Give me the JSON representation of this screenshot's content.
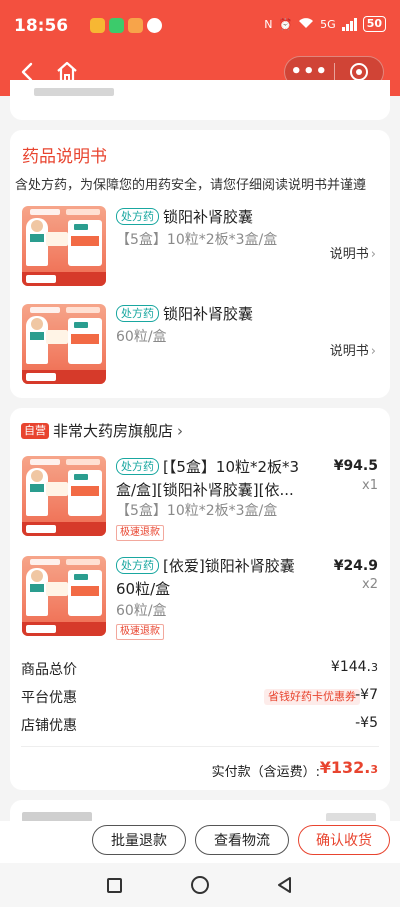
{
  "status_bar": {
    "time": "18:56",
    "network": "5G",
    "battery": "50"
  },
  "header": {
    "back_icon": "chevron-left-icon",
    "home_icon": "home-icon",
    "more_icon": "more-dots-icon",
    "close_icon": "target-icon"
  },
  "manual_section": {
    "title": "药品说明书",
    "notice": "含处方药，为保障您的用药安全，请您仔细阅读说明书并谨遵",
    "items": [
      {
        "rx": "处方药",
        "name": "锁阳补肾胶囊",
        "spec": "【5盒】10粒*2板*3盒/盒",
        "link": "说明书"
      },
      {
        "rx": "处方药",
        "name": "锁阳补肾胶囊",
        "spec": "60粒/盒",
        "link": "说明书"
      }
    ]
  },
  "store_section": {
    "self_tag": "自营",
    "store_name": "非常大药房旗舰店",
    "items": [
      {
        "rx": "处方药",
        "name_line1": "【5盒】10粒*2板*3",
        "name_line2": "盒/盒][锁阳补肾胶囊][依...",
        "name_prefix": "[",
        "spec": "【5盒】10粒*2板*3盒/盒",
        "tag": "极速退款",
        "price": "¥94.5",
        "qty": "x1"
      },
      {
        "rx": "处方药",
        "name_line1": "[依爱]锁阳补肾胶囊",
        "name_line2": "60粒/盒",
        "spec": "60粒/盒",
        "tag": "极速退款",
        "price": "¥24.9",
        "qty": "x2"
      }
    ],
    "summary": {
      "total_label": "商品总价",
      "total_value_main": "¥144.",
      "total_value_dec": "3",
      "platform_label": "平台优惠",
      "platform_coupon": "省钱好药卡优惠券",
      "platform_value": "-¥7",
      "store_label": "店铺优惠",
      "store_value": "-¥5",
      "paid_label": "实付款（含运费）:",
      "paid_value_main": "¥132.",
      "paid_value_dec": "3"
    }
  },
  "actions": {
    "batch_refund": "批量退款",
    "view_logistics": "查看物流",
    "confirm_receipt": "确认收货"
  },
  "colors": {
    "brand_red": "#f3503f",
    "accent_red": "#e8442f",
    "rx_teal": "#19a7a0"
  }
}
